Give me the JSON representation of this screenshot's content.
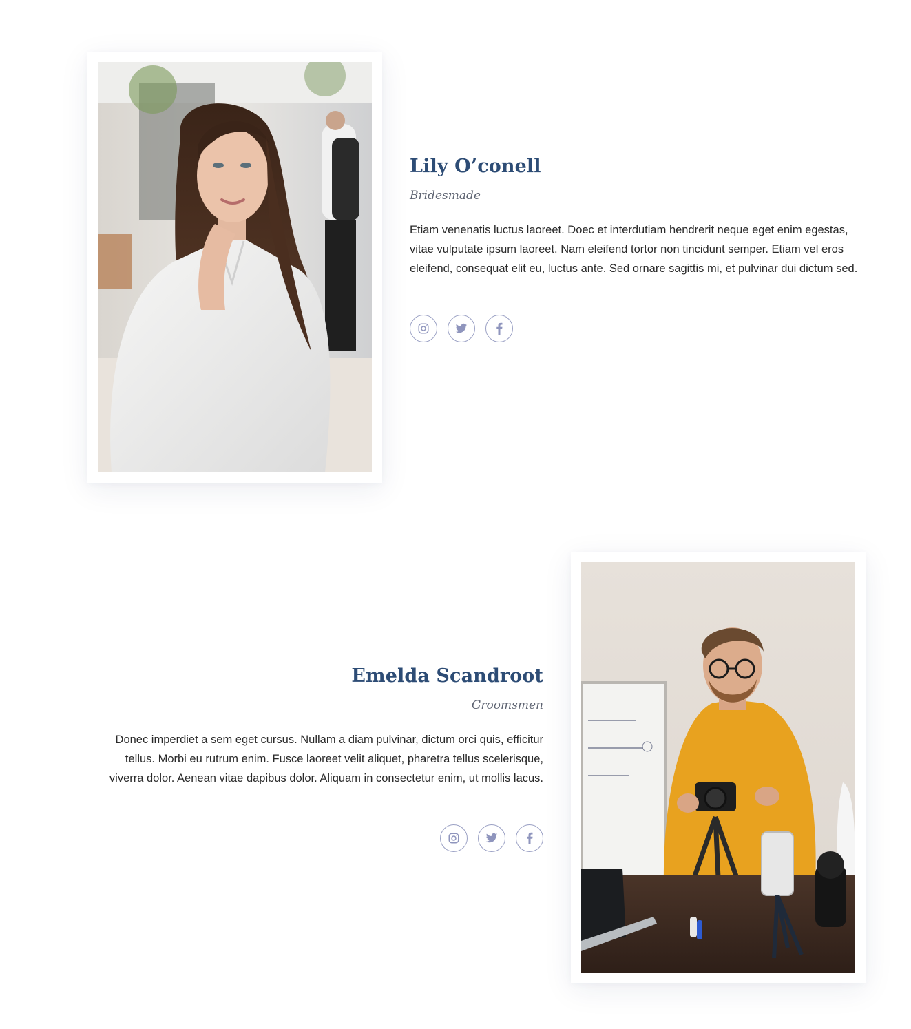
{
  "members": [
    {
      "name": "Lily O’conell",
      "role": "Bridesmade",
      "bio": "Etiam venenatis luctus laoreet. Doec et interdutiam hendrerit neque eget enim egestas, vitae vulputate ipsum laoreet. Nam eleifend tortor non tincidunt semper. Etiam vel eros eleifend, consequat elit eu, luctus ante. Sed ornare sagittis mi, et pulvinar dui dictum sed.",
      "socials": [
        "instagram-icon",
        "twitter-icon",
        "facebook-icon"
      ]
    },
    {
      "name": "Emelda Scandroot",
      "role": "Groomsmen",
      "bio": "Donec imperdiet a sem eget cursus. Nullam a diam pulvinar, dictum orci quis, efficitur tellus. Morbi eu rutrum enim. Fusce laoreet velit aliquet, pharetra tellus scelerisque, viverra dolor. Aenean vitae dapibus dolor. Aliquam in consectetur enim, ut mollis lacus.",
      "socials": [
        "instagram-icon",
        "twitter-icon",
        "facebook-icon"
      ]
    }
  ],
  "colors": {
    "name": "#2d4c75",
    "role": "#5e6472",
    "icon": "#8f95bd",
    "sweater": "#e8a21f"
  }
}
